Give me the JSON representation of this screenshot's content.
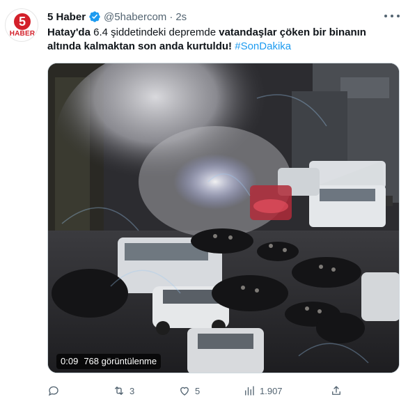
{
  "author": {
    "name": "5 Haber",
    "handle": "@5habercom",
    "separator": "·",
    "time": "2s",
    "avatar_number": "5",
    "avatar_word": "HABER",
    "avatar_color": "#d3202a",
    "verified_icon": "verified-badge-icon"
  },
  "tweet": {
    "part1": "Hatay'da",
    "part2": " 6.4 şiddetindeki depremde ",
    "part3": "vatandaşlar çöken bir binanın altında kalmaktan son anda kurtuldu!",
    "space": " ",
    "hashtag": "#SonDakika"
  },
  "media": {
    "duration": "0:09",
    "views": "768 görüntülenme"
  },
  "actions": {
    "reply_count": "",
    "retweet_count": "3",
    "like_count": "5",
    "view_count": "1.907",
    "share_count": ""
  },
  "colors": {
    "accent": "#1d9bf0",
    "secondary_text": "#536471"
  }
}
